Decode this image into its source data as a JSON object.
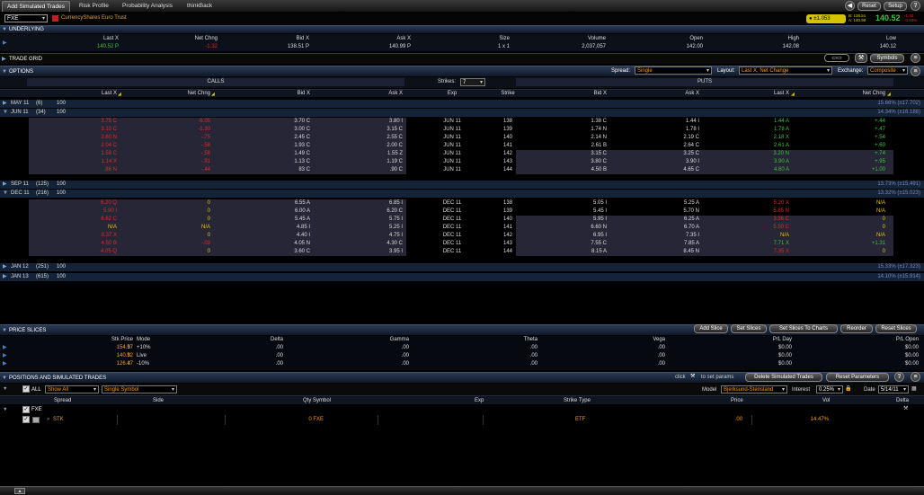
{
  "tabs": [
    "Add Simulated Trades",
    "Risk Profile",
    "Probability Analysis",
    "thinkBack"
  ],
  "top_buttons": {
    "reset": "Reset",
    "setup": "Setup"
  },
  "symbol": {
    "value": "FXE",
    "name": "CurrencyShares Euro Trust"
  },
  "quote_box": {
    "badge": "±1.053",
    "bid_small": "B: 138.51",
    "ask_small": "A: 140.99",
    "last": "140.52",
    "net": "-1.32",
    "pct": "-0.93%"
  },
  "underlying": {
    "title": "UNDERLYING",
    "headers": [
      "Last X",
      "Net Chng",
      "Bid X",
      "Ask X",
      "Size",
      "Volume",
      "Open",
      "High",
      "Low"
    ],
    "values": [
      "140.52 P",
      "-1.32",
      "138.51 P",
      "140.99 P",
      "1 x 1",
      "2,037,057",
      "142.00",
      "142.08",
      "140.12"
    ]
  },
  "trade_grid": {
    "title": "TRADE GRID",
    "symbols_btn": "Symbols"
  },
  "options": {
    "title": "OPTIONS",
    "spread_label": "Spread:",
    "spread_value": "Single",
    "layout_label": "Layout:",
    "layout_value": "Last X, Net Change",
    "exchange_label": "Exchange:",
    "exchange_value": "Composite",
    "calls_label": "CALLS",
    "puts_label": "PUTS",
    "strikes_label": "Strikes:",
    "strikes_value": "7",
    "col_headers": [
      "Last X",
      "Net Chng",
      "Bid X",
      "Ask X",
      "Exp",
      "Strike",
      "Bid X",
      "Ask X",
      "Last X",
      "Net Chng"
    ],
    "groups": [
      {
        "label": "MAY 11",
        "days": "(6)",
        "mult": "100",
        "pct": "15.66% (±17.702)"
      },
      {
        "label": "JUN 11",
        "days": "(34)",
        "mult": "100",
        "pct": "14.34% (±16.188)"
      },
      {
        "label": "SEP 11",
        "days": "(125)",
        "mult": "100",
        "pct": "13.73% (±15.491)"
      },
      {
        "label": "DEC 11",
        "days": "(216)",
        "mult": "100",
        "pct": "13.32% (±15.023)"
      },
      {
        "label": "JAN 12",
        "days": "(251)",
        "mult": "100",
        "pct": "15.33% (±17.323)"
      },
      {
        "label": "JAN 13",
        "days": "(615)",
        "mult": "100",
        "pct": "14.10% (±15.914)"
      }
    ],
    "jun_rows": [
      [
        "3.75 C",
        "-6.05",
        "3.70 C",
        "3.80 I",
        "JUN 11",
        "138",
        "1.38 C",
        "1.44 I",
        "1.44 A",
        "+.44"
      ],
      [
        "3.10 C",
        "-1.30",
        "3.00 C",
        "3.15 C",
        "JUN 11",
        "139",
        "1.74 N",
        "1.78 I",
        "1.78 A",
        "+.47"
      ],
      [
        "2.60 N",
        "-.75",
        "2.45 C",
        "2.55 C",
        "JUN 11",
        "140",
        "2.14 N",
        "2.19 C",
        "2.18 X",
        "+.54"
      ],
      [
        "2.04 C",
        "-.58",
        "1.93 C",
        "2.00 C",
        "JUN 11",
        "141",
        "2.61 B",
        "2.64 C",
        "2.61 A",
        "+.60"
      ],
      [
        "1.59 C",
        "-.58",
        "1.49 C",
        "1.55 Z",
        "JUN 11",
        "142",
        "3.15 C",
        "3.25 C",
        "3.20 N",
        "+.74"
      ],
      [
        "1.14 X",
        "-.91",
        "1.13 C",
        "1.19 C",
        "JUN 11",
        "143",
        "3.80 C",
        "3.90 I",
        "3.90 A",
        "+.95"
      ],
      [
        ".86 N",
        "-.44",
        "83 C",
        ".90 C",
        "JUN 11",
        "144",
        "4.50 B",
        "4.65 C",
        "4.60 A",
        "+1.00"
      ]
    ],
    "dec_rows": [
      [
        "6.20 Q",
        "0",
        "6.55 A",
        "6.85 I",
        "DEC 11",
        "138",
        "5.05 I",
        "5.25 A",
        "5.20 X",
        "N/A"
      ],
      [
        "5.90 I",
        "0",
        "6.00 A",
        "6.20 C",
        "DEC 11",
        "139",
        "5.45 I",
        "5.70 N",
        "5.85 N",
        "N/A"
      ],
      [
        "6.62 C",
        "0",
        "5.45 A",
        "5.75 I",
        "DEC 11",
        "140",
        "5.95 I",
        "6.25 A",
        "3.36 C",
        "0"
      ],
      [
        "N/A",
        "N/A",
        "4.85 I",
        "5.25 I",
        "DEC 11",
        "141",
        "6.60 N",
        "6.70 A",
        "5.50 C",
        "0"
      ],
      [
        "8.37 X",
        "0",
        "4.40 I",
        "4.75 I",
        "DEC 11",
        "142",
        "6.95 I",
        "7.35 I",
        "N/A",
        "N/A"
      ],
      [
        "4.50 B",
        "-.03",
        "4.05 N",
        "4.30 C",
        "DEC 11",
        "143",
        "7.55 C",
        "7.85 A",
        "7.71 X",
        "+1.31"
      ],
      [
        "4.05 Q",
        "0",
        "3.60 C",
        "3.95 I",
        "DEC 11",
        "144",
        "8.15 A",
        "8.45 N",
        "7.35 X",
        "0"
      ]
    ]
  },
  "price_slices": {
    "title": "PRICE SLICES",
    "buttons": [
      "Add Slice",
      "Set Slices",
      "Set Slices To Charts",
      "Reorder",
      "Reset Slices"
    ],
    "headers": [
      "Stk Price",
      "Mode",
      "Delta",
      "Gamma",
      "Theta",
      "Vega",
      "P/L Day",
      "P/L Open"
    ],
    "rows": [
      [
        "154.57",
        "+10%",
        ".00",
        ".00",
        ".00",
        ".00",
        "$0.00",
        "$0.00"
      ],
      [
        "140.52",
        "Live",
        ".00",
        ".00",
        ".00",
        ".00",
        "$0.00",
        "$0.00"
      ],
      [
        "126.47",
        "-10%",
        ".00",
        ".00",
        ".00",
        ".00",
        "$0.00",
        "$0.00"
      ]
    ]
  },
  "positions": {
    "title": "POSITIONS AND SIMULATED TRADES",
    "click_hint_pre": "click",
    "click_hint_post": "to set params",
    "delete_btn": "Delete Simulated Trades",
    "reset_params_btn": "Reset Parameters",
    "all_label": "ALL",
    "show_value": "Show All",
    "symbol_mode": "Single Symbol",
    "model_label": "Model",
    "model_value": "Bjerksund-Stensland",
    "interest_label": "Interest",
    "interest_value": "0.25%",
    "date_label": "Date",
    "date_value": "5/14/11",
    "headers": [
      "Spread",
      "Side",
      "Qty Symbol",
      "Exp",
      "Strike Type",
      "Price",
      "Vol",
      "Delta"
    ],
    "group": "FXE",
    "row": {
      "spread": "STK",
      "qty_symbol": "0 FXE",
      "type": "ETF",
      "price": ".00",
      "vol": "14.47%"
    }
  }
}
